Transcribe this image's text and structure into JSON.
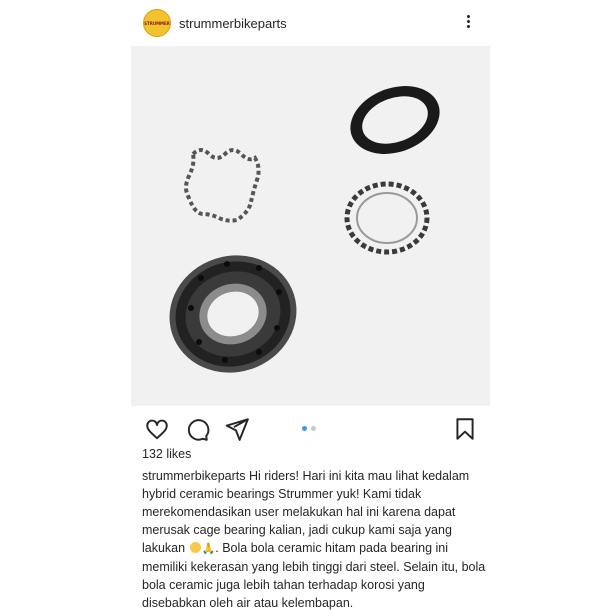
{
  "post": {
    "username": "strummerbikeparts",
    "avatar_label": "STRUMMER",
    "likes": "132 likes",
    "caption": {
      "user": "strummerbikeparts",
      "text_1": " Hi riders! Hari ini kita mau lihat kedalam hybrid ceramic bearings Strummer yuk! Kami tidak merekomendasikan user melakukan hal ini karena dapat merusak cage bearing kalian, jadi cukup kami saja yang lakukan ",
      "emoji_2": "🙏",
      "text_2": ". Bola bola ceramic hitam pada bearing ini memiliki kekerasan yang lebih tinggi dari steel. Selain itu, bola bola ceramic juga lebih tahan terhadap korosi yang disebabkan oleh air atau kelembapan."
    }
  },
  "icons": {
    "more": "more-vertical-icon",
    "like": "heart-icon",
    "comment": "comment-icon",
    "share": "send-icon",
    "save": "bookmark-icon"
  },
  "carousel": {
    "count": 2,
    "active": 1
  },
  "colors": {
    "accent": "#3897f0",
    "avatar": "#f2c230",
    "text": "#262626"
  }
}
